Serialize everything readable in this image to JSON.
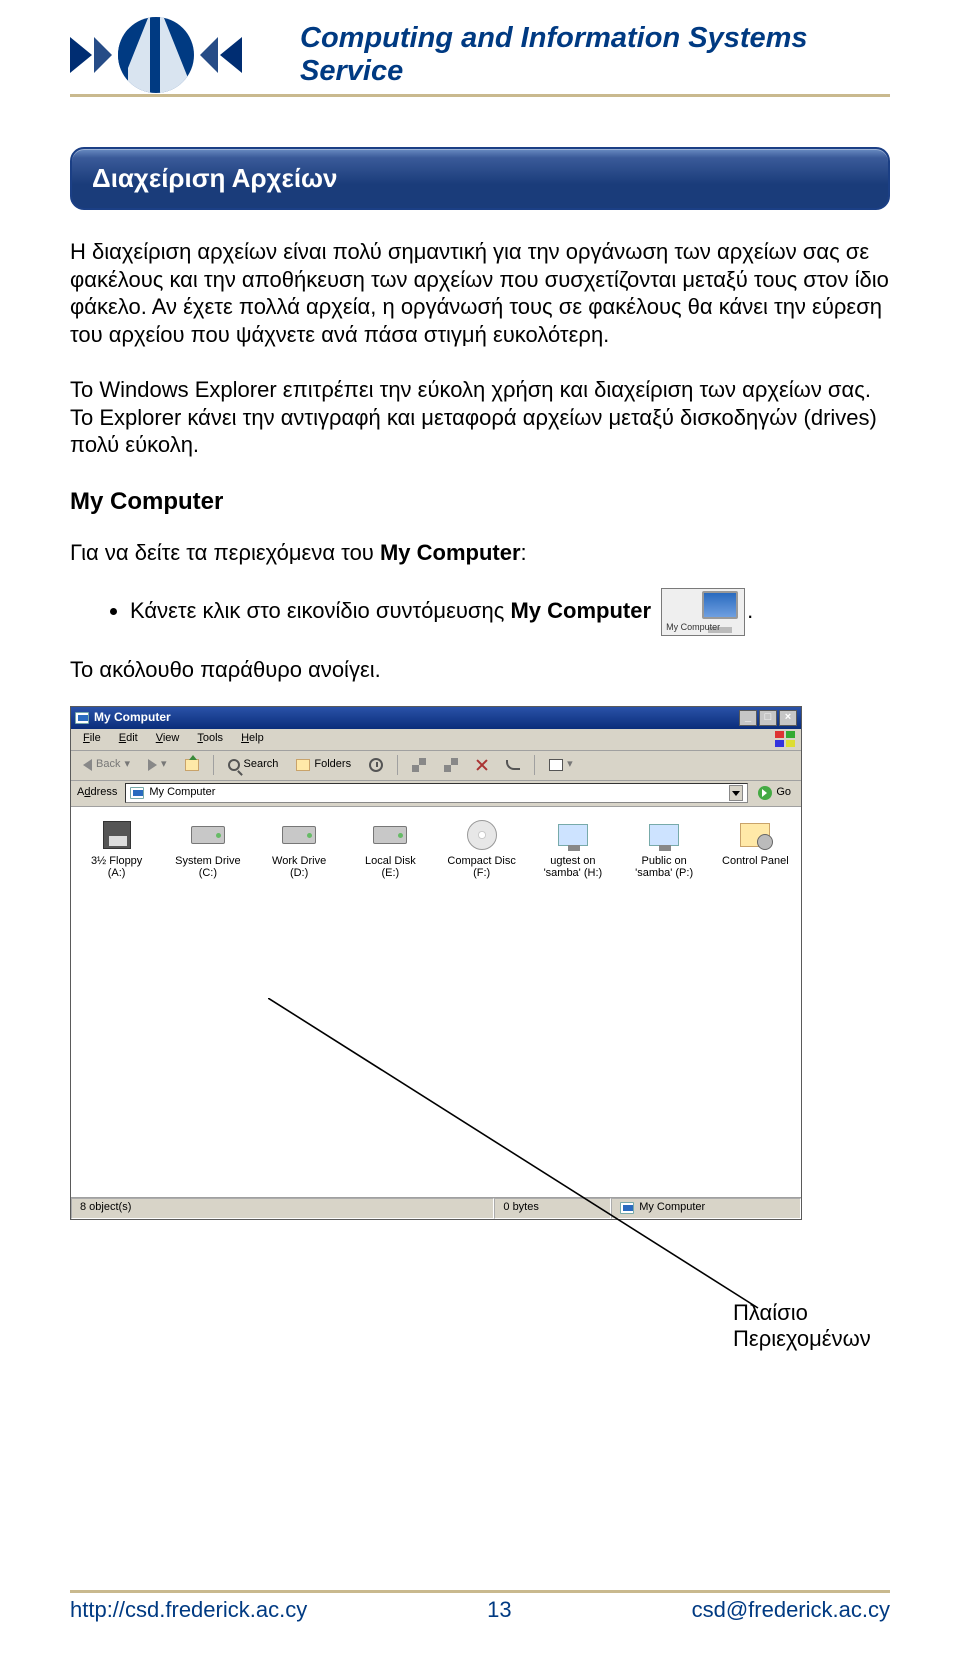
{
  "header": {
    "site_title": "Computing and Information Systems Service"
  },
  "section": {
    "title": "Διαχείριση Αρχείων"
  },
  "paragraphs": {
    "p1": "Η διαχείριση αρχείων είναι πολύ σημαντική για την οργάνωση των αρχείων σας σε φακέλους και την αποθήκευση των αρχείων που συσχετίζονται μεταξύ τους στον ίδιο φάκελο. Αν έχετε πολλά αρχεία, η οργάνωσή τους σε φακέλους θα κάνει την εύρεση του αρχείου που ψάχνετε ανά πάσα στιγμή ευκολότερη.",
    "p2": "Το Windows Explorer επιτρέπει την εύκολη χρήση και διαχείριση των αρχείων σας. Το Explorer κάνει την αντιγραφή και μεταφορά αρχείων μεταξύ δισκοδηγών (drives) πολύ εύκολη."
  },
  "mycomputer": {
    "heading": "My Computer",
    "intro_pre": "Για να δείτε τα περιεχόμενα του ",
    "intro_bold": "My Computer",
    "intro_post": ":",
    "bullet_pre": "Κάνετε κλικ στο εικονίδιο συντόμευσης ",
    "bullet_bold": "My Computer",
    "bullet_post": ".",
    "followup": "Το ακόλουθο παράθυρο ανοίγει.",
    "shortcut_caption": "My Computer"
  },
  "window": {
    "title": "My Computer",
    "menus": [
      "File",
      "Edit",
      "View",
      "Tools",
      "Help"
    ],
    "toolbar": {
      "back": "Back",
      "search": "Search",
      "folders": "Folders"
    },
    "address": {
      "label": "Address",
      "value": "My Computer",
      "go": "Go"
    },
    "items": [
      {
        "label": "3½ Floppy (A:)",
        "icon": "floppy"
      },
      {
        "label": "System Drive (C:)",
        "icon": "hdd"
      },
      {
        "label": "Work Drive (D:)",
        "icon": "hdd"
      },
      {
        "label": "Local Disk (E:)",
        "icon": "hdd"
      },
      {
        "label": "Compact Disc (F:)",
        "icon": "cd"
      },
      {
        "label": "ugtest on 'samba' (H:)",
        "icon": "net"
      },
      {
        "label": "Public on 'samba' (P:)",
        "icon": "net"
      },
      {
        "label": "Control Panel",
        "icon": "cp"
      }
    ],
    "status": {
      "left": "8 object(s)",
      "mid": "0 bytes",
      "right": "My Computer"
    }
  },
  "callout": {
    "line1": "Πλαίσιο",
    "line2": "Περιεχομένων"
  },
  "footer": {
    "left": "http://csd.frederick.ac.cy",
    "center": "13",
    "right": "csd@frederick.ac.cy"
  }
}
